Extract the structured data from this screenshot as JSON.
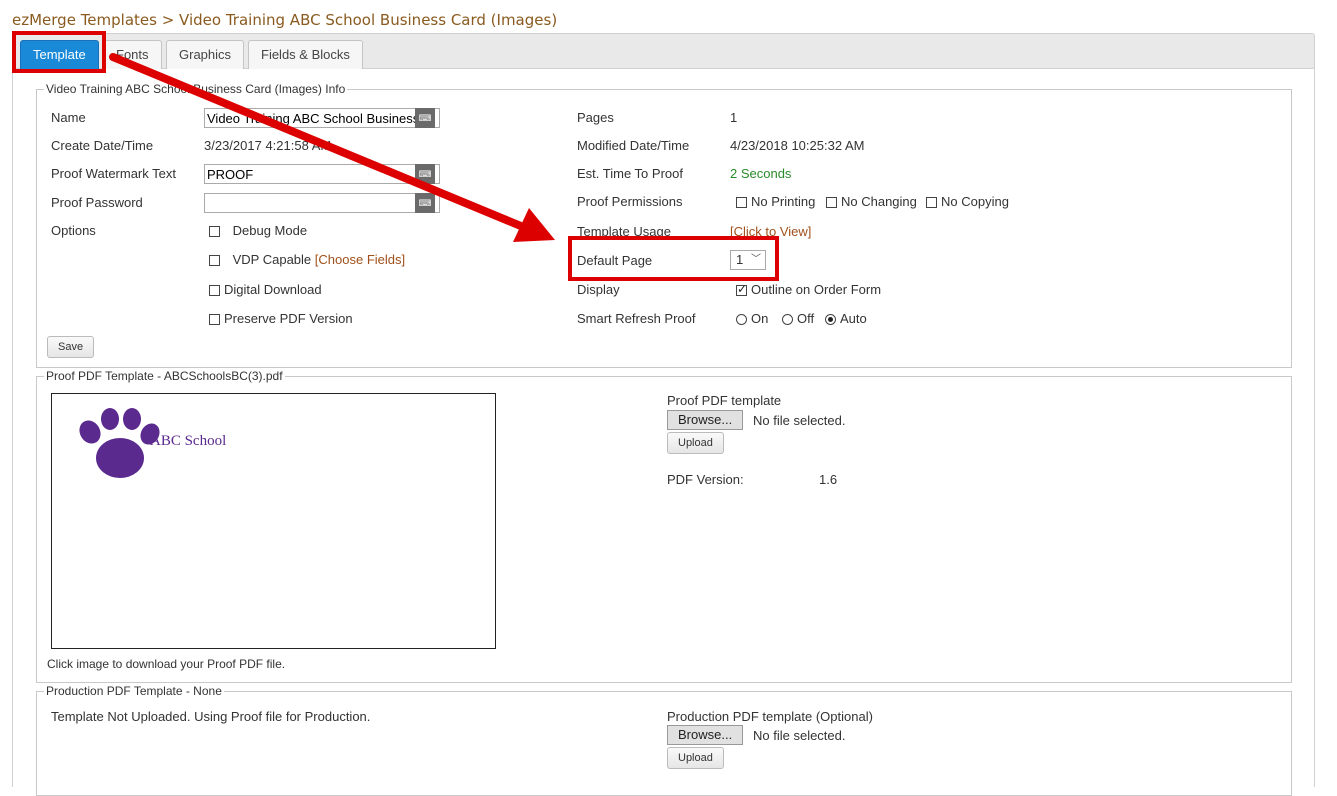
{
  "breadcrumb": "ezMerge Templates > Video Training ABC School Business Card (Images)",
  "tabs": [
    {
      "label": "Template"
    },
    {
      "label": "Fonts"
    },
    {
      "label": "Graphics"
    },
    {
      "label": "Fields & Blocks"
    }
  ],
  "info": {
    "legend": "Video Training ABC School Business Card (Images) Info",
    "name_label": "Name",
    "name_value": "Video Training ABC School Business Card (Images)",
    "create_label": "Create Date/Time",
    "create_value": "3/23/2017 4:21:58 AM",
    "watermark_label": "Proof Watermark Text",
    "watermark_value": "PROOF",
    "password_label": "Proof Password",
    "password_value": "",
    "options_label": "Options",
    "debug_label": "Debug Mode",
    "vdp_label": "VDP Capable",
    "choose_fields": "[Choose Fields]",
    "digital_label": "Digital Download",
    "preserve_label": "Preserve PDF Version",
    "save_label": "Save",
    "pages_label": "Pages",
    "pages_value": "1",
    "modified_label": "Modified Date/Time",
    "modified_value": "4/23/2018 10:25:32 AM",
    "est_label": "Est. Time To Proof",
    "est_value": "2 Seconds",
    "perm_label": "Proof Permissions",
    "no_printing": "No Printing",
    "no_changing": "No Changing",
    "no_copying": "No Copying",
    "usage_label": "Template Usage",
    "usage_link": "[Click to View]",
    "default_page_label": "Default Page",
    "default_page_value": "1",
    "display_label": "Display",
    "outline_label": "Outline on Order Form",
    "refresh_label": "Smart Refresh Proof",
    "refresh_on": "On",
    "refresh_off": "Off",
    "refresh_auto": "Auto"
  },
  "proof": {
    "legend": "Proof PDF Template - ABCSchoolsBC(3).pdf",
    "preview_text": "ABC School",
    "caption": "Click image to download your Proof PDF file.",
    "upload_title": "Proof PDF template",
    "browse_label": "Browse...",
    "no_file": "No file selected.",
    "upload_label": "Upload",
    "version_label": "PDF Version:",
    "version_value": "1.6"
  },
  "production": {
    "legend": "Production PDF Template - None",
    "note": "Template Not Uploaded. Using Proof file for Production.",
    "upload_title": "Production PDF template (Optional)",
    "browse_label": "Browse...",
    "no_file": "No file selected.",
    "upload_label": "Upload"
  },
  "colors": {
    "accent": "#1a8ad8",
    "highlight": "#dd0000",
    "paw": "#5a2a8f"
  }
}
